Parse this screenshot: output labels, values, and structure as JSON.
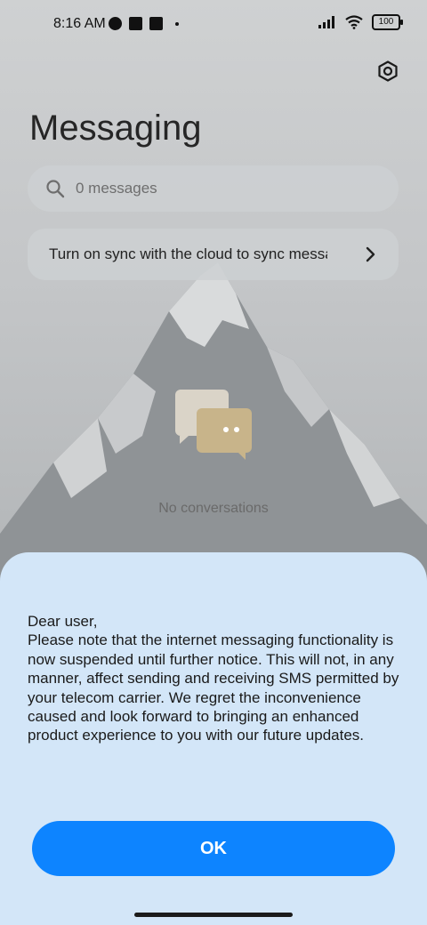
{
  "status_bar": {
    "time": "8:16 AM",
    "battery": "100"
  },
  "header": {
    "title": "Messaging"
  },
  "search": {
    "placeholder": "0 messages"
  },
  "sync_banner": {
    "text": "Turn on sync with the cloud to sync messages"
  },
  "empty_state": {
    "text": "No conversations"
  },
  "dialog": {
    "message": "Dear user,\nPlease note that the internet messaging functionality is now suspended until further notice. This will not, in any manner, affect sending and receiving SMS permitted by your telecom carrier. We regret the inconvenience caused and look forward to bringing an enhanced product experience to you with our future updates.",
    "ok_label": "OK"
  },
  "colors": {
    "accent": "#0d84ff",
    "sheet_bg": "#d3e6f8"
  }
}
